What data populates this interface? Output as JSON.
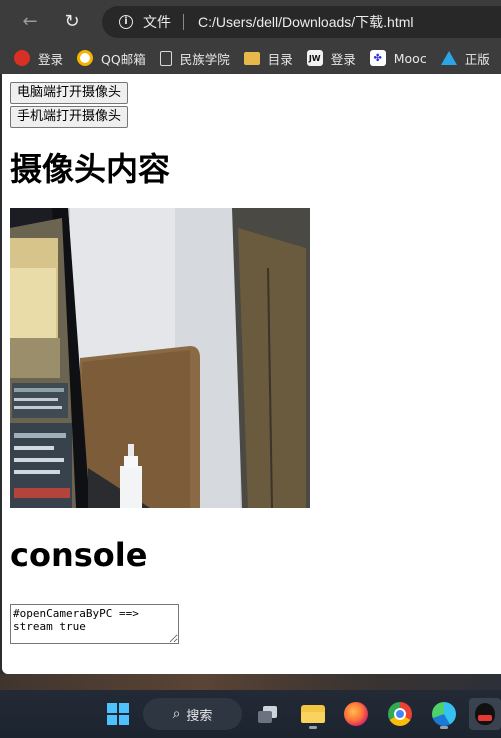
{
  "browser": {
    "back_icon": "←",
    "reload_icon": "↻",
    "info_icon": "i",
    "file_label": "文件",
    "url": "C:/Users/dell/Downloads/下载.html"
  },
  "bookmarks": [
    {
      "label": "登录",
      "icon": "red-circle-icon"
    },
    {
      "label": "QQ邮箱",
      "icon": "qq-mail-icon"
    },
    {
      "label": "民族学院",
      "icon": "page-icon"
    },
    {
      "label": "目录",
      "icon": "folder-icon"
    },
    {
      "label": "登录",
      "icon": "jw-icon"
    },
    {
      "label": "Mooc",
      "icon": "baidu-paw-icon"
    },
    {
      "label": "正版",
      "icon": "triangle-icon"
    }
  ],
  "page": {
    "buttons": {
      "pc_camera": "电脑端打开摄像头",
      "mobile_camera": "手机端打开摄像头"
    },
    "camera_heading": "摄像头内容",
    "console_heading": "console",
    "console_text": "#openCameraByPC ==>\nstream true"
  },
  "taskbar": {
    "search_label": "搜索",
    "search_icon": "⌕"
  }
}
